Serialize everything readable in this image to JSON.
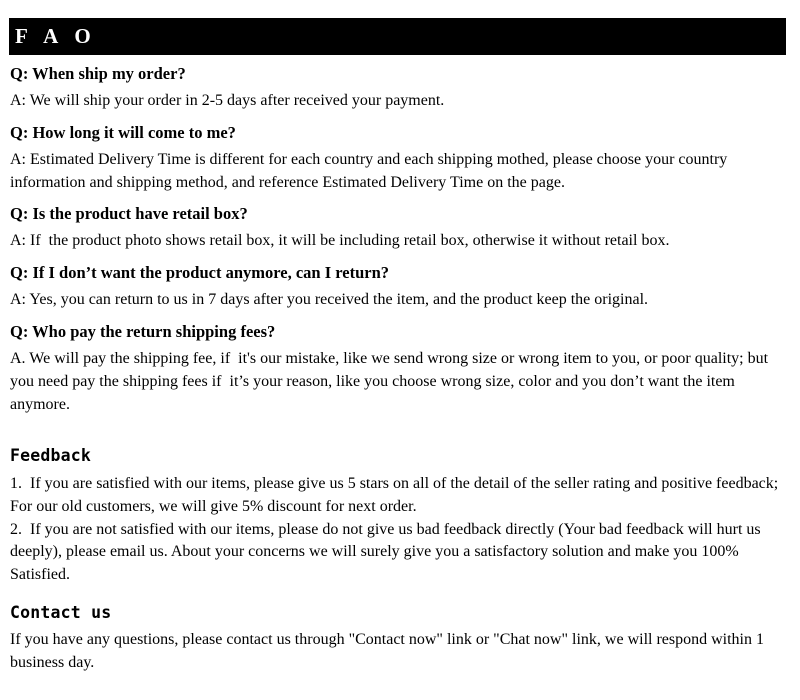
{
  "banner": {
    "title": "F A O"
  },
  "faq": {
    "items": [
      {
        "question": "Q: When ship my order?",
        "answer": "A: We will ship your order in 2-5 days after received your payment."
      },
      {
        "question": "Q: How long it will come to me?",
        "answer": "A: Estimated Delivery Time is different for each country and each shipping mothed, please choose your country information and shipping method, and reference Estimated Delivery Time on the page."
      },
      {
        "question": "Q: Is the product have retail box?",
        "answer": "A: If  the product photo shows retail box, it will be including retail box, otherwise it without retail box."
      },
      {
        "question": "Q: If I don’t want the product anymore, can I return?",
        "answer": "A: Yes, you can return to us in 7 days after you received the item, and the product keep the original."
      },
      {
        "question": "Q: Who pay the return shipping fees?",
        "answer": "A. We will pay the shipping fee, if  it's our mistake, like we send wrong size or wrong item to you, or poor quality; but you need pay the shipping fees if  it’s your reason, like you choose wrong size, color and you don’t want the item anymore."
      }
    ]
  },
  "feedback": {
    "heading": "Feedback",
    "items": [
      "1.  If you are satisfied with our items, please give us 5 stars on all of the detail of the seller rating and positive feedback; For our old customers, we will give 5% discount for next order.",
      "2.  If you are not satisfied with our items, please do not give us bad feedback directly (Your bad feedback will hurt us deeply), please email us. About your concerns we will surely give you a satisfactory solution and make you 100% Satisfied."
    ]
  },
  "contact": {
    "heading": "Contact us",
    "text": "If you have any questions, please contact us through \"Contact now\" link or \"Chat now\" link, we will respond within 1 business day."
  }
}
